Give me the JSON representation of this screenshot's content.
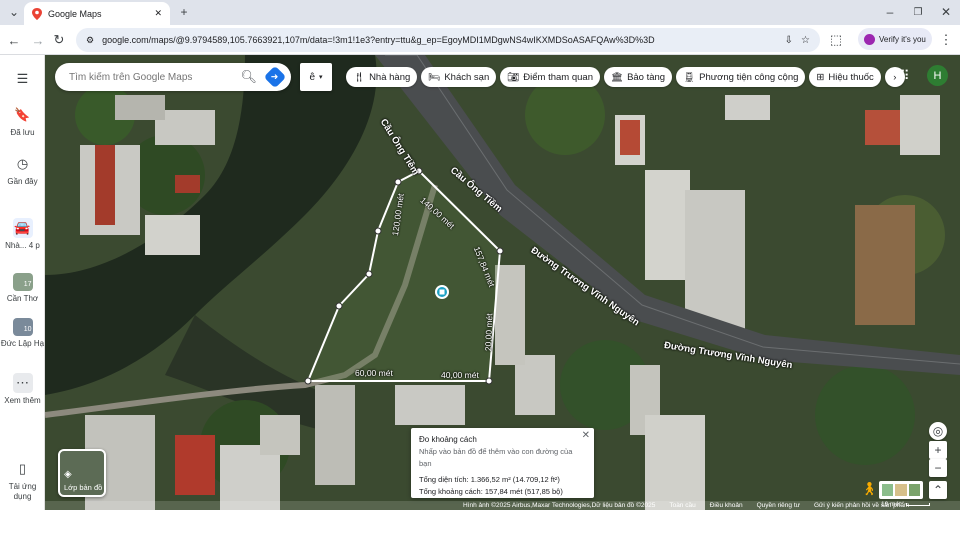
{
  "browser": {
    "tab_title": "Google Maps",
    "url": "google.com/maps/@9.9794589,105.7663921,107m/data=!3m1!1e3?entry=ttu&g_ep=EgoyMDI1MDgwNS4wIKXMDSoASAFQAw%3D%3D",
    "verify_label": "Verify it's you",
    "new_tab_label": "+",
    "close_tab_label": "✕"
  },
  "sidebar": {
    "menu_icon": "hamburger-icon",
    "items": [
      {
        "label": "Đã lưu",
        "icon": "bookmark-icon"
      },
      {
        "label": "Gần đây",
        "icon": "history-icon"
      },
      {
        "label": "Nhà... 4 p",
        "icon": "car-icon"
      },
      {
        "label": "Cần Thơ",
        "icon": "place-thumbnail"
      },
      {
        "label": "Đức Lập Hạ",
        "icon": "place-thumbnail"
      },
      {
        "label": "Xem thêm",
        "icon": "more-icon"
      },
      {
        "label": "Tải ứng dụng",
        "icon": "phone-icon"
      }
    ]
  },
  "search": {
    "placeholder": "Tìm kiếm trên Google Maps"
  },
  "lang_button": "ê",
  "chips": [
    {
      "label": "Nhà hàng",
      "icon": "restaurant-icon"
    },
    {
      "label": "Khách sạn",
      "icon": "hotel-icon"
    },
    {
      "label": "Điểm tham quan",
      "icon": "camera-icon"
    },
    {
      "label": "Bảo tàng",
      "icon": "museum-icon"
    },
    {
      "label": "Phương tiện công cộng",
      "icon": "transit-icon"
    },
    {
      "label": "Hiệu thuốc",
      "icon": "pharmacy-icon"
    }
  ],
  "avatar_letter": "H",
  "map_labels": {
    "bridge1": "Cầu Ông Tiềm",
    "bridge2": "Cầu Ông Tiềm",
    "road1": "Đường Trương Vĩnh Nguyên",
    "road2": "Đường Trương Vĩnh Nguyên",
    "measures": [
      "140,00 mét",
      "120,00 mét",
      "157,84 mét",
      "20,00 mét",
      "60,00 mét",
      "40,00 mét"
    ]
  },
  "measure_card": {
    "title": "Đo khoảng cách",
    "hint": "Nhấp vào bản đồ để thêm vào con đường của bạn",
    "area": "Tổng diện tích: 1.366,52 m² (14.709,12 ft²)",
    "distance": "Tổng khoảng cách: 157,84 mét (517,85 bộ)"
  },
  "layer_button": "Lớp bản đồ",
  "attribution": {
    "imagery": "Hình ảnh ©2025 Airbus,Maxar Technologies,Dữ liệu bản đồ ©2025",
    "links": [
      "Toàn cầu",
      "Điều khoản",
      "Quyền riêng tư",
      "Gửi ý kiến phản hồi về sản phẩm"
    ],
    "scale": "10 mét"
  }
}
